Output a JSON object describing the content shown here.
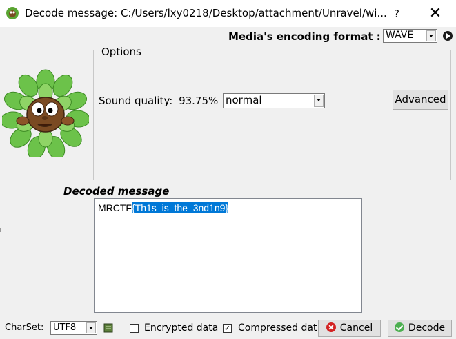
{
  "window": {
    "title": "Decode message: C:/Users/lxy0218/Desktop/attachment/Unravel/wi...",
    "help_label": "?",
    "close_label": "✕"
  },
  "media": {
    "label": "Media's encoding format :",
    "format": "WAVE",
    "play_icon": "play-icon"
  },
  "options": {
    "group_title": "Options",
    "sound_quality_label": "Sound quality:",
    "sound_quality_value": "93.75%",
    "quality_setting": "normal",
    "advanced_label": "Advanced"
  },
  "decoded": {
    "heading": "Decoded message",
    "text_plain": "MRCTF",
    "text_selected": "{Th1s_is_the_3nd1n9}"
  },
  "footer": {
    "charset_label": "CharSet:",
    "charset_value": "UTF8",
    "encrypted_label": "Encrypted data",
    "encrypted_checked": false,
    "compressed_label": "Compressed dat",
    "compressed_checked": true,
    "check_mark": "✓",
    "cancel_label": "Cancel",
    "decode_label": "Decode"
  },
  "colors": {
    "selection": "#0078d7",
    "cancel_icon": "#d32222",
    "decode_icon": "#4caf50",
    "leaf_green": "#6cc24a"
  }
}
